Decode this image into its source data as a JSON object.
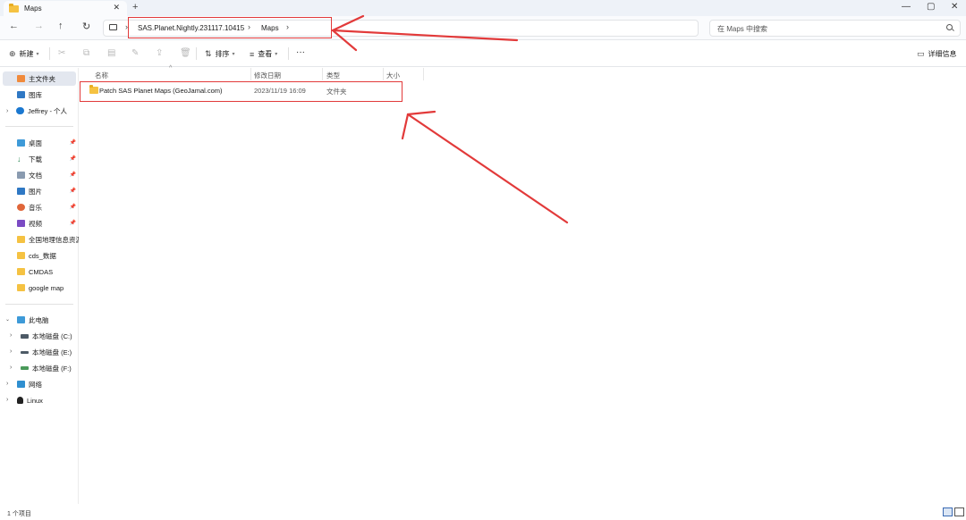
{
  "titlebar": {
    "tab_title": "Maps",
    "close_tab": "✕",
    "new_tab": "+",
    "minimize": "—",
    "maximize": "▢",
    "close_window": "✕"
  },
  "nav": {
    "back": "←",
    "forward": "→",
    "up": "↑",
    "refresh": "↻",
    "breadcrumbs": [
      "SAS.Planet.Nightly.231117.10415",
      "Maps"
    ],
    "separator": "›",
    "search_placeholder": "在 Maps 中搜索"
  },
  "toolbar": {
    "new_label": "新建",
    "sort_label": "排序",
    "view_label": "查看",
    "more": "···",
    "details_label": "详细信息"
  },
  "sidebar": {
    "items": [
      {
        "label": "主文件夹",
        "icon": "home-icon"
      },
      {
        "label": "图库",
        "icon": "gallery-icon"
      },
      {
        "label": "Jeffrey - 个人",
        "icon": "cloud-icon"
      },
      {
        "label": "桌面",
        "icon": "desktop-icon"
      },
      {
        "label": "下载",
        "icon": "download-icon"
      },
      {
        "label": "文档",
        "icon": "document-icon"
      },
      {
        "label": "图片",
        "icon": "pictures-icon"
      },
      {
        "label": "音乐",
        "icon": "music-icon"
      },
      {
        "label": "视频",
        "icon": "video-icon"
      },
      {
        "label": "全国地理信息资源目",
        "icon": "folder-icon"
      },
      {
        "label": "cds_数据",
        "icon": "folder-icon"
      },
      {
        "label": "CMDAS",
        "icon": "folder-icon"
      },
      {
        "label": "google map",
        "icon": "folder-icon"
      },
      {
        "label": "此电脑",
        "icon": "pc-icon"
      },
      {
        "label": "本地磁盘 (C:)",
        "icon": "drive-icon"
      },
      {
        "label": "本地磁盘 (E:)",
        "icon": "drive-icon"
      },
      {
        "label": "本地磁盘 (F:)",
        "icon": "drive-icon"
      },
      {
        "label": "网络",
        "icon": "network-icon"
      },
      {
        "label": "Linux",
        "icon": "linux-icon"
      }
    ]
  },
  "columns": {
    "name": "名称",
    "modified": "修改日期",
    "type": "类型",
    "size": "大小"
  },
  "files": [
    {
      "name": "Patch SAS Planet Maps (GeoJamal.com)",
      "modified": "2023/11/19 16:09",
      "type": "文件夹",
      "size": ""
    }
  ],
  "status": {
    "count_text": "1 个项目"
  },
  "colors": {
    "annotation": "#e23a3a",
    "folder": "#f5c242",
    "accent": "#3b6bb3"
  }
}
